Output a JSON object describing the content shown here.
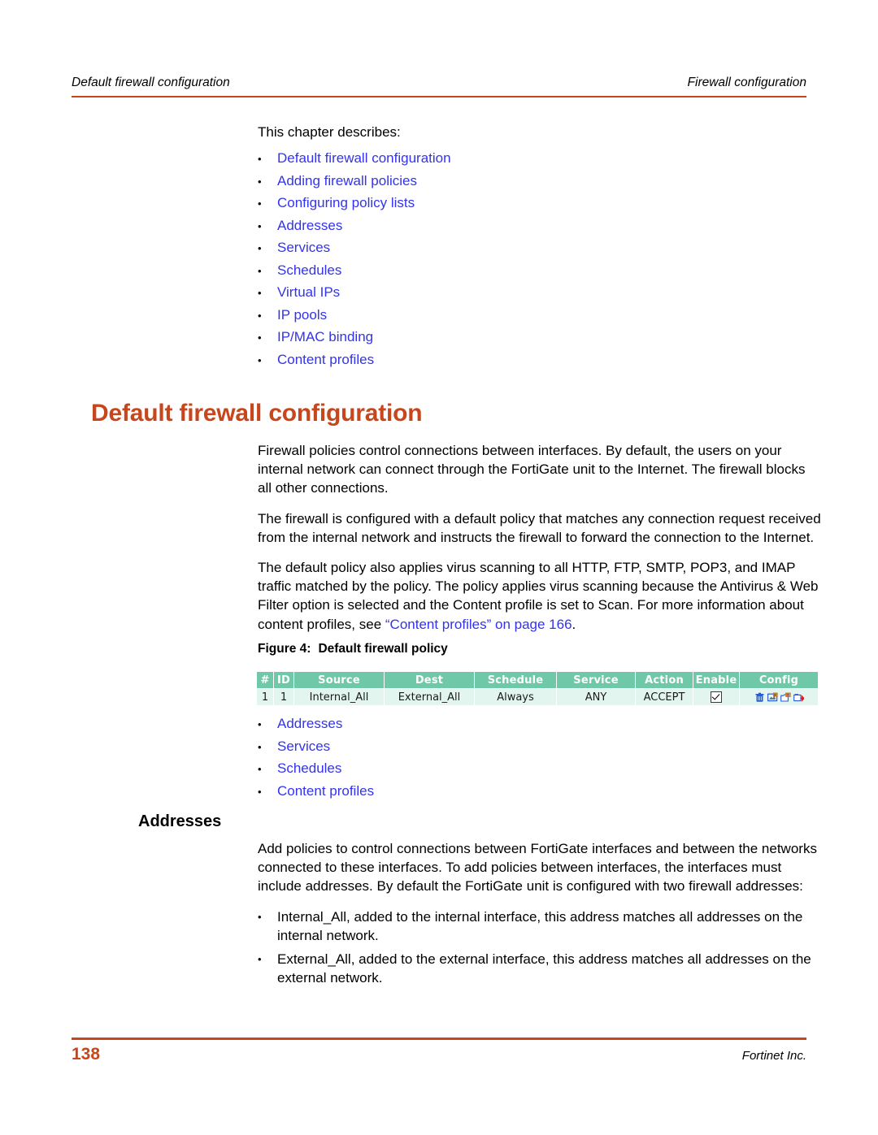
{
  "header": {
    "left": "Default firewall configuration",
    "right": "Firewall configuration",
    "rule_color": "#C8461C"
  },
  "intro": {
    "lead": "This chapter describes:",
    "bullet": "•",
    "links": [
      {
        "label": "Default firewall configuration"
      },
      {
        "label": "Adding firewall policies"
      },
      {
        "label": "Configuring policy lists"
      },
      {
        "label": "Addresses"
      },
      {
        "label": "Services"
      },
      {
        "label": "Schedules"
      },
      {
        "label": "Virtual IPs"
      },
      {
        "label": "IP pools"
      },
      {
        "label": "IP/MAC binding"
      },
      {
        "label": "Content profiles"
      }
    ]
  },
  "heading1": {
    "text": "Default firewall configuration",
    "color": "#C8461C"
  },
  "paragraphs": {
    "p1": "Firewall policies control connections between interfaces. By default, the users on your internal network can connect through the FortiGate unit to the Internet. The firewall blocks all other connections.",
    "p2": "The firewall is configured with a default policy that matches any connection request received from the internal network and instructs the firewall to forward the connection to the Internet.",
    "p3_before": "The default policy also applies virus scanning to all HTTP, FTP, SMTP, POP3, and IMAP traffic matched by the policy. The policy applies virus scanning because the Antivirus & Web Filter option is selected and the Content profile is set to Scan. For more information about content profiles, see ",
    "p3_link": "“Content profiles” on page 166",
    "p3_after": "."
  },
  "figure": {
    "number": "Figure 4:",
    "title": "Default firewall policy",
    "table": {
      "header_bg": "#6FC8A7",
      "row_bg": "#E2F6EF",
      "columns": [
        "#",
        "ID",
        "Source",
        "Dest",
        "Schedule",
        "Service",
        "Action",
        "Enable",
        "Config"
      ],
      "rows": [
        {
          "num": "1",
          "id": "1",
          "source": "Internal_All",
          "dest": "External_All",
          "schedule": "Always",
          "service": "ANY",
          "action": "ACCEPT",
          "enable_checked": true,
          "config_icons": [
            "delete-icon",
            "edit-icon",
            "clone-icon",
            "insert-icon"
          ]
        }
      ]
    }
  },
  "mid_links": {
    "bullet": "•",
    "links": [
      {
        "label": "Addresses"
      },
      {
        "label": "Services"
      },
      {
        "label": "Schedules"
      },
      {
        "label": "Content profiles"
      }
    ]
  },
  "heading2": {
    "text": "Addresses"
  },
  "addresses_section": {
    "intro": "Add policies to control connections between FortiGate interfaces and between the networks connected to these interfaces. To add policies between interfaces, the interfaces must include addresses. By default the FortiGate unit is configured with two firewall addresses:",
    "bullet": "•",
    "items": [
      {
        "text": "Internal_All, added to the internal interface, this address matches all addresses on the internal network."
      },
      {
        "text": "External_All, added to the external interface, this address matches all addresses on the external network."
      }
    ]
  },
  "footer": {
    "page_number": "138",
    "company": "Fortinet Inc.",
    "rule_color": "#C8461C"
  }
}
